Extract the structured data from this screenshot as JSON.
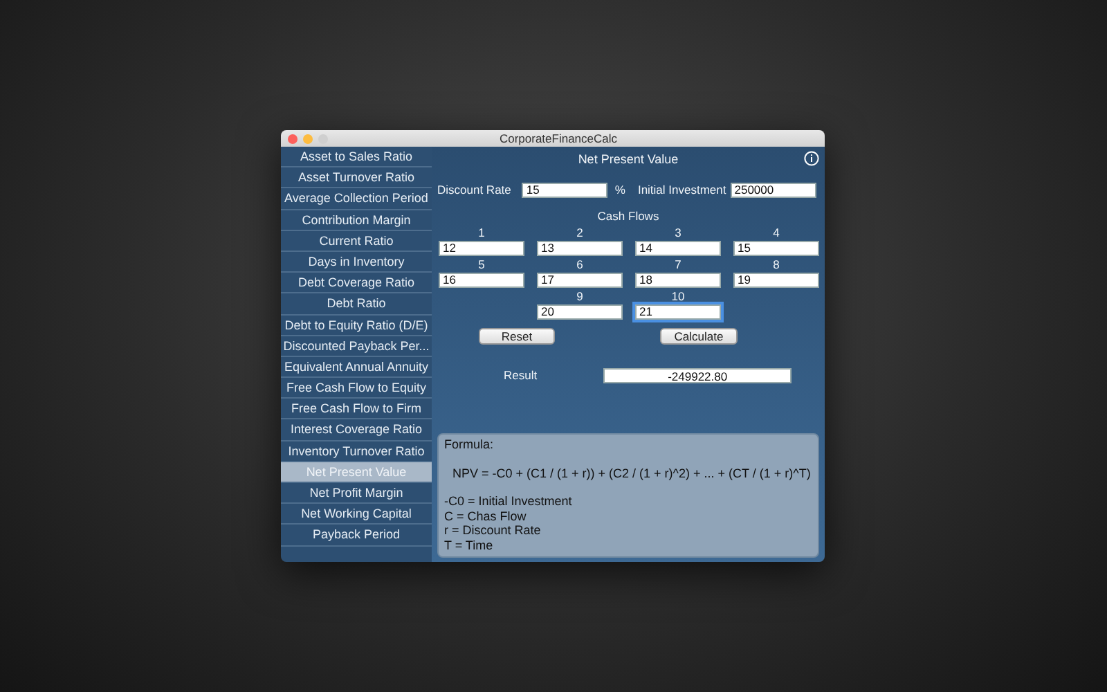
{
  "window": {
    "title": "CorporateFinanceCalc"
  },
  "sidebar": {
    "items": [
      {
        "label": "Asset to Sales Ratio",
        "selected": false
      },
      {
        "label": "Asset Turnover Ratio",
        "selected": false
      },
      {
        "label": "Average Collection Period",
        "selected": false
      },
      {
        "label": "Contribution Margin",
        "selected": false
      },
      {
        "label": "Current Ratio",
        "selected": false
      },
      {
        "label": "Days in Inventory",
        "selected": false
      },
      {
        "label": "Debt Coverage Ratio",
        "selected": false
      },
      {
        "label": "Debt Ratio",
        "selected": false
      },
      {
        "label": "Debt to Equity Ratio (D/E)",
        "selected": false
      },
      {
        "label": "Discounted Payback Per...",
        "selected": false
      },
      {
        "label": "Equivalent Annual Annuity",
        "selected": false
      },
      {
        "label": "Free Cash Flow to Equity",
        "selected": false
      },
      {
        "label": "Free Cash Flow to Firm",
        "selected": false
      },
      {
        "label": "Interest Coverage Ratio",
        "selected": false
      },
      {
        "label": "Inventory Turnover Ratio",
        "selected": false
      },
      {
        "label": "Net Present Value",
        "selected": true
      },
      {
        "label": "Net Profit Margin",
        "selected": false
      },
      {
        "label": "Net Working Capital",
        "selected": false
      },
      {
        "label": "Payback Period",
        "selected": false
      }
    ]
  },
  "panel": {
    "title": "Net Present Value",
    "discount_rate": {
      "label": "Discount Rate",
      "value": "15",
      "unit": "%"
    },
    "initial_investment": {
      "label": "Initial Investment",
      "value": "250000"
    },
    "cash_flows_title": "Cash Flows",
    "cash_flows": [
      {
        "label": "1",
        "value": "12",
        "focused": false
      },
      {
        "label": "2",
        "value": "13",
        "focused": false
      },
      {
        "label": "3",
        "value": "14",
        "focused": false
      },
      {
        "label": "4",
        "value": "15",
        "focused": false
      },
      {
        "label": "5",
        "value": "16",
        "focused": false
      },
      {
        "label": "6",
        "value": "17",
        "focused": false
      },
      {
        "label": "7",
        "value": "18",
        "focused": false
      },
      {
        "label": "8",
        "value": "19",
        "focused": false
      },
      {
        "label": "9",
        "value": "20",
        "focused": false
      },
      {
        "label": "10",
        "value": "21",
        "focused": true
      }
    ],
    "buttons": [
      "Reset",
      "Calculate"
    ],
    "result": {
      "label": "Result",
      "value": "-249922.80"
    },
    "formula": {
      "heading": "Formula:",
      "equation": "NPV = -C0 + (C1 / (1 + r)) + (C2 / (1 + r)^2) + ... + (CT / (1 + r)^T)",
      "legend": [
        "-C0 = Initial Investment",
        "C = Chas Flow",
        "r = Discount Rate",
        "T = Time"
      ]
    }
  }
}
